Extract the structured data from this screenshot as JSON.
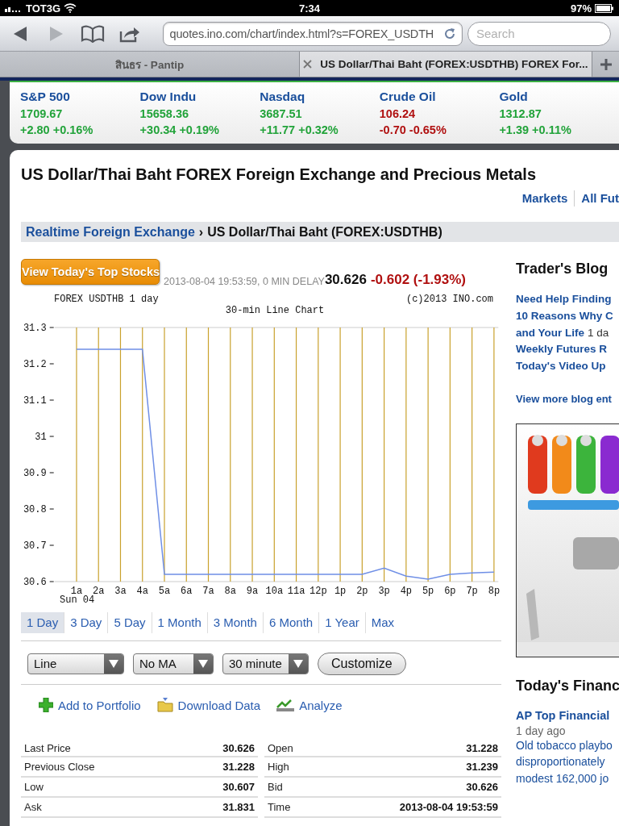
{
  "status_bar": {
    "carrier": "TOT3G",
    "time": "7:34",
    "battery": "97%"
  },
  "browser": {
    "nav_buttons": [
      {
        "kind": "back",
        "disabled": false
      },
      {
        "kind": "forward",
        "disabled": true
      }
    ],
    "url": "quotes.ino.com/chart/index.html?s=FOREX_USDTH",
    "search_placeholder": "Search"
  },
  "tabs": [
    {
      "label": "สินธร - Pantip",
      "selected": false
    },
    {
      "label": "US Dollar/Thai Baht (FOREX:USDTHB) FOREX For...",
      "selected": true
    }
  ],
  "ticker": [
    {
      "name": "S&P 500",
      "price": "1709.67",
      "change": "+2.80 +0.16%",
      "color": "#22a33a"
    },
    {
      "name": "Dow Indu",
      "price": "15658.36",
      "change": "+30.34 +0.19%",
      "color": "#22a33a"
    },
    {
      "name": "Nasdaq",
      "price": "3687.51",
      "change": "+11.77 +0.32%",
      "color": "#22a33a"
    },
    {
      "name": "Crude Oil",
      "price": "106.24",
      "change": "-0.70 -0.65%",
      "color": "#b01010"
    },
    {
      "name": "Gold",
      "price": "1312.87",
      "change": "+1.39 +0.11%",
      "color": "#22a33a"
    }
  ],
  "page": {
    "title": "US Dollar/Thai Baht FOREX Foreign Exchange and Precious Metals",
    "nav": [
      "Markets",
      "All Fut"
    ],
    "breadcrumb": {
      "link": "Realtime Foreign Exchange",
      "separator": "›",
      "current": "US Dollar/Thai Baht (FOREX:USDTHB)"
    }
  },
  "quote": {
    "button": "View Today's Top Stocks",
    "timestamp": "2013-08-04 19:53:59, 0 MIN DELAY",
    "price": "30.626",
    "change": "-0.602 (-1.93%)"
  },
  "chart": {
    "caption_left": "FOREX USDTHB 1 day",
    "caption_right": "(c)2013 INO.com",
    "date_label": "Sun 04",
    "chart_data": {
      "type": "line",
      "title": "30-min Line Chart",
      "categories": [
        "1a",
        "2a",
        "3a",
        "4a",
        "5a",
        "6a",
        "7a",
        "8a",
        "9a",
        "10a",
        "11a",
        "12p",
        "1p",
        "2p",
        "3p",
        "4p",
        "5p",
        "6p",
        "7p",
        "8p"
      ],
      "series": [
        {
          "color": "#6f8fe6",
          "values": [
            31.24,
            31.24,
            31.24,
            31.24,
            30.62,
            30.62,
            30.62,
            30.62,
            30.62,
            30.62,
            30.62,
            30.62,
            30.62,
            30.62,
            30.637,
            30.615,
            30.607,
            30.62,
            30.624,
            30.626
          ]
        }
      ],
      "ylim": [
        30.6,
        31.3
      ],
      "grid": true,
      "yticks": [
        31.3,
        31.2,
        31.1,
        31,
        30.9,
        30.8,
        30.7,
        30.6
      ]
    }
  },
  "periods": [
    {
      "label": "1 Day",
      "selected": true
    },
    {
      "label": "3 Day",
      "selected": false
    },
    {
      "label": "5 Day",
      "selected": false
    },
    {
      "label": "1 Month",
      "selected": false
    },
    {
      "label": "3 Month",
      "selected": false
    },
    {
      "label": "6 Month",
      "selected": false
    },
    {
      "label": "1 Year",
      "selected": false
    },
    {
      "label": "Max",
      "selected": false
    }
  ],
  "controls": {
    "dropdowns": [
      "Line",
      "No MA",
      "30 minute"
    ],
    "button": "Customize"
  },
  "actions": [
    {
      "label": "Add to Portfolio",
      "kind": "add"
    },
    {
      "label": "Download Data",
      "kind": "download"
    },
    {
      "label": "Analyze",
      "kind": "analyze"
    }
  ],
  "stats": {
    "left": [
      {
        "label": "Last Price",
        "value": "30.626"
      },
      {
        "label": "Previous Close",
        "value": "31.228"
      },
      {
        "label": "Low",
        "value": "30.607"
      },
      {
        "label": "Ask",
        "value": "31.831"
      }
    ],
    "right": [
      {
        "label": "Open",
        "value": "31.228"
      },
      {
        "label": "High",
        "value": "31.239"
      },
      {
        "label": "Bid",
        "value": "30.626"
      },
      {
        "label": "Time",
        "value": "2013-08-04 19:53:59"
      }
    ]
  },
  "blog": {
    "title": "Trader's Blog",
    "items": [
      {
        "title": "Need Help Finding"
      },
      {
        "title": "10 Reasons Why C"
      },
      {
        "title": "and Your Life",
        "age": "1 da"
      },
      {
        "title": "Weekly Futures R"
      },
      {
        "title": "Today's Video Up"
      }
    ],
    "more": "View more blog ent"
  },
  "news": {
    "title": "Today's Financ",
    "headline": "AP Top Financial",
    "age": "1 day ago",
    "lines": [
      "Old tobacco playbo",
      "disproportionately",
      "modest 162,000 jo"
    ]
  }
}
